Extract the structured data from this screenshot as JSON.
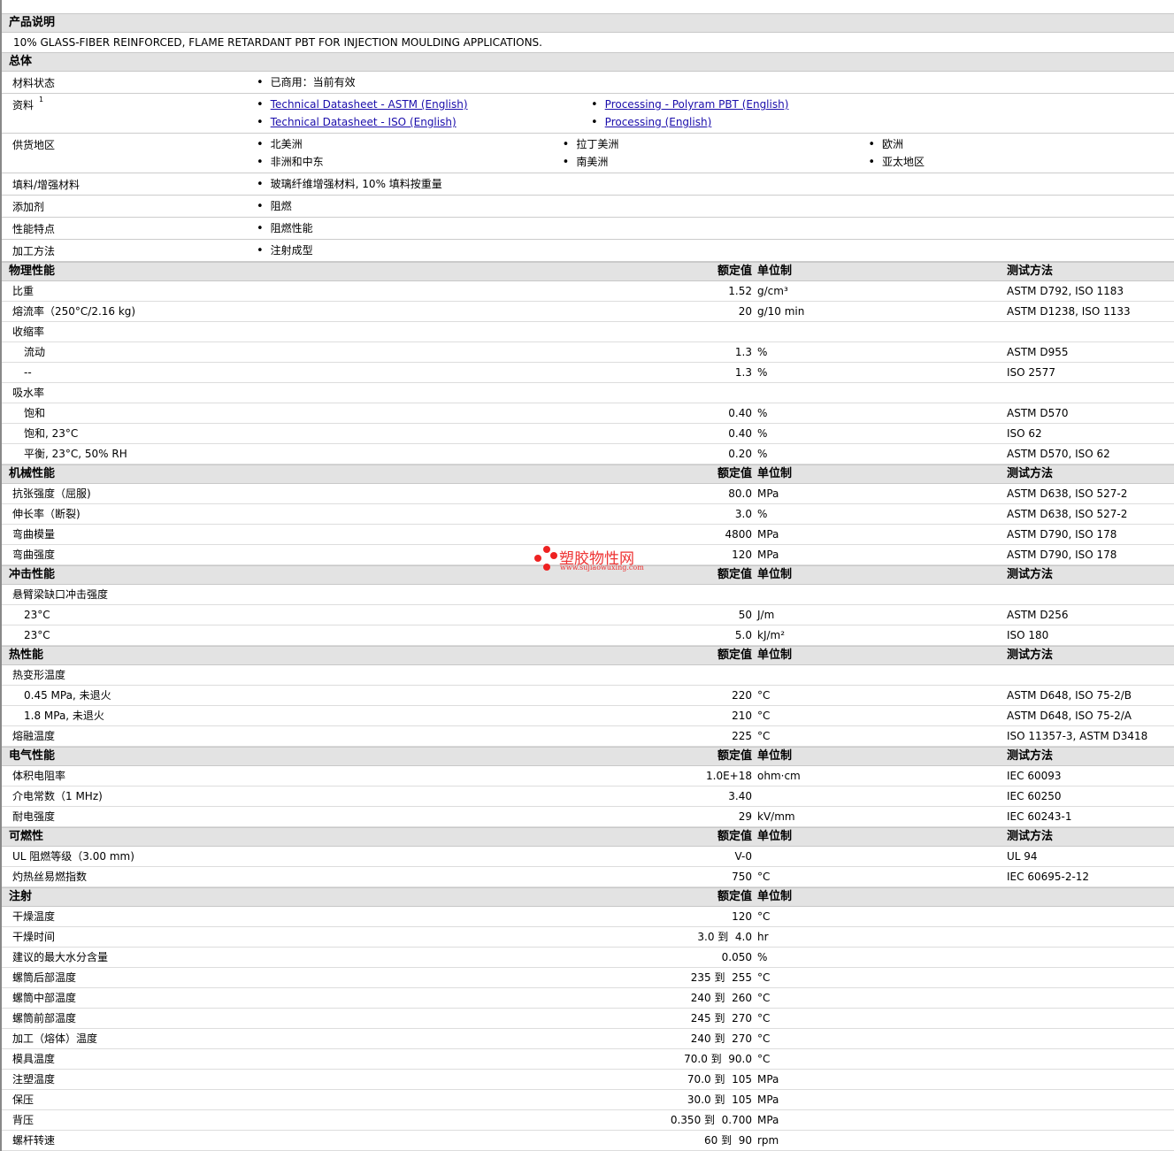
{
  "description": {
    "title": "产品说明",
    "text": "10% GLASS-FIBER REINFORCED, FLAME RETARDANT PBT FOR INJECTION MOULDING APPLICATIONS."
  },
  "general": {
    "title": "总体",
    "rows": [
      {
        "label": "材料状态",
        "cols": [
          [
            "已商用：当前有效"
          ]
        ]
      },
      {
        "label": "资料",
        "sup": "1",
        "links": true,
        "cols": [
          [
            "Technical Datasheet - ASTM (English)",
            "Technical Datasheet - ISO (English)"
          ],
          [
            "Processing - Polyram PBT (English)",
            "Processing (English)"
          ]
        ]
      },
      {
        "label": "供货地区",
        "cols": [
          [
            "北美洲",
            "非洲和中东"
          ],
          [
            "拉丁美洲",
            "南美洲"
          ],
          [
            "欧洲",
            "亚太地区"
          ]
        ]
      },
      {
        "label": "填料/增强材料",
        "cols": [
          [
            "玻璃纤维增强材料, 10% 填料按重量"
          ]
        ]
      },
      {
        "label": "添加剂",
        "cols": [
          [
            "阻燃"
          ]
        ]
      },
      {
        "label": "性能特点",
        "cols": [
          [
            "阻燃性能"
          ]
        ]
      },
      {
        "label": "加工方法",
        "cols": [
          [
            "注射成型"
          ]
        ]
      }
    ]
  },
  "headers": {
    "value": "额定值",
    "unit": "单位制",
    "method": "测试方法"
  },
  "sections": [
    {
      "title": "物理性能",
      "method": true,
      "rows": [
        {
          "label": "比重",
          "value": "1.52",
          "unit": "g/cm³",
          "method": "ASTM D792, ISO 1183"
        },
        {
          "label": "熔流率（250°C/2.16 kg)",
          "value": "20",
          "unit": "g/10 min",
          "method": "ASTM D1238, ISO 1133"
        },
        {
          "label": "收缩率"
        },
        {
          "label": "流动",
          "indent": true,
          "value": "1.3",
          "unit": "%",
          "method": "ASTM D955"
        },
        {
          "label": "--",
          "indent": true,
          "value": "1.3",
          "unit": "%",
          "method": "ISO 2577"
        },
        {
          "label": "吸水率"
        },
        {
          "label": "饱和",
          "indent": true,
          "value": "0.40",
          "unit": "%",
          "method": "ASTM D570"
        },
        {
          "label": "饱和, 23°C",
          "indent": true,
          "value": "0.40",
          "unit": "%",
          "method": "ISO 62"
        },
        {
          "label": "平衡, 23°C, 50% RH",
          "indent": true,
          "value": "0.20",
          "unit": "%",
          "method": "ASTM D570, ISO 62"
        }
      ]
    },
    {
      "title": "机械性能",
      "method": true,
      "rows": [
        {
          "label": "抗张强度（屈服)",
          "value": "80.0",
          "unit": "MPa",
          "method": "ASTM D638, ISO 527-2"
        },
        {
          "label": "伸长率（断裂)",
          "value": "3.0",
          "unit": "%",
          "method": "ASTM D638, ISO 527-2"
        },
        {
          "label": "弯曲模量",
          "value": "4800",
          "unit": "MPa",
          "method": "ASTM D790, ISO 178"
        },
        {
          "label": "弯曲强度",
          "value": "120",
          "unit": "MPa",
          "method": "ASTM D790, ISO 178"
        }
      ]
    },
    {
      "title": "冲击性能",
      "method": true,
      "rows": [
        {
          "label": "悬臂梁缺口冲击强度"
        },
        {
          "label": "23°C",
          "indent": true,
          "value": "50",
          "unit": "J/m",
          "method": "ASTM D256"
        },
        {
          "label": "23°C",
          "indent": true,
          "value": "5.0",
          "unit": "kJ/m²",
          "method": "ISO 180"
        }
      ]
    },
    {
      "title": "热性能",
      "method": true,
      "rows": [
        {
          "label": "热变形温度"
        },
        {
          "label": "0.45 MPa, 未退火",
          "indent": true,
          "value": "220",
          "unit": "°C",
          "method": "ASTM D648, ISO 75-2/B"
        },
        {
          "label": "1.8 MPa, 未退火",
          "indent": true,
          "value": "210",
          "unit": "°C",
          "method": "ASTM D648, ISO 75-2/A"
        },
        {
          "label": "熔融温度",
          "value": "225",
          "unit": "°C",
          "method": "ISO 11357-3, ASTM D3418"
        }
      ]
    },
    {
      "title": "电气性能",
      "method": true,
      "rows": [
        {
          "label": "体积电阻率",
          "value": "1.0E+18",
          "unit": "ohm·cm",
          "method": "IEC 60093"
        },
        {
          "label": "介电常数（1 MHz)",
          "value": "3.40",
          "unit": "",
          "method": "IEC 60250"
        },
        {
          "label": "耐电强度",
          "value": "29",
          "unit": "kV/mm",
          "method": "IEC 60243-1"
        }
      ]
    },
    {
      "title": "可燃性",
      "method": true,
      "rows": [
        {
          "label": "UL 阻燃等级（3.00 mm)",
          "value": "V-0",
          "unit": "",
          "method": "UL 94"
        },
        {
          "label": "灼热丝易燃指数",
          "value": "750",
          "unit": "°C",
          "method": "IEC 60695-2-12"
        }
      ]
    },
    {
      "title": "注射",
      "method": false,
      "rows": [
        {
          "label": "干燥温度",
          "value": "120",
          "unit": "°C"
        },
        {
          "label": "干燥时间",
          "value": "3.0 到  4.0",
          "unit": "hr"
        },
        {
          "label": "建议的最大水分含量",
          "value": "0.050",
          "unit": "%"
        },
        {
          "label": "螺筒后部温度",
          "value": "235 到  255",
          "unit": "°C"
        },
        {
          "label": "螺筒中部温度",
          "value": "240 到  260",
          "unit": "°C"
        },
        {
          "label": "螺筒前部温度",
          "value": "245 到  270",
          "unit": "°C"
        },
        {
          "label": "加工（熔体）温度",
          "value": "240 到  270",
          "unit": "°C"
        },
        {
          "label": "模具温度",
          "value": "70.0 到  90.0",
          "unit": "°C"
        },
        {
          "label": "注塑温度",
          "value": "70.0 到  105",
          "unit": "MPa"
        },
        {
          "label": "保压",
          "value": "30.0 到  105",
          "unit": "MPa"
        },
        {
          "label": "背压",
          "value": "0.350 到  0.700",
          "unit": "MPa"
        },
        {
          "label": "螺杆转速",
          "value": "60 到  90",
          "unit": "rpm"
        }
      ]
    }
  ],
  "watermark": {
    "name": "塑胶物性网",
    "url": "www.sujiaowuxing.com"
  }
}
